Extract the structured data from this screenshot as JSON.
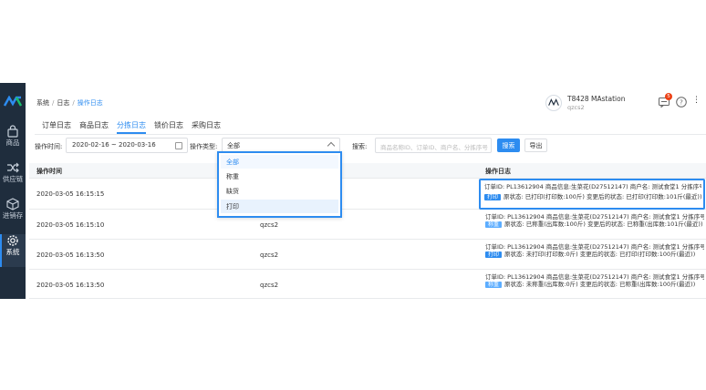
{
  "sidebar": {
    "items": [
      {
        "label": "商品",
        "icon": "bag-icon"
      },
      {
        "label": "供应链",
        "icon": "shuffle-icon"
      },
      {
        "label": "进销存",
        "icon": "cube-icon"
      },
      {
        "label": "系统",
        "icon": "gear-icon"
      }
    ],
    "accent": "#1f2d3d"
  },
  "breadcrumb": {
    "root": "系统",
    "mid": "日志",
    "current": "操作日志"
  },
  "store": {
    "name": "T8428 MAstation",
    "user": "qzcs2"
  },
  "notifications": {
    "count": "5"
  },
  "tabs": [
    {
      "label": "订单日志"
    },
    {
      "label": "商品日志"
    },
    {
      "label": "分拣日志"
    },
    {
      "label": "锁价日志"
    },
    {
      "label": "采购日志"
    }
  ],
  "filters": {
    "time_label": "操作时间:",
    "date_range": "2020-02-16 ~ 2020-03-16",
    "type_label": "操作类型:",
    "type_value": "全部",
    "search_label": "搜索:",
    "search_placeholder": "商品名称ID、订单ID、商户名、分拣序号",
    "search_button": "搜索",
    "export_button": "导出"
  },
  "dropdown": {
    "options": [
      "全部",
      "称重",
      "缺货",
      "打印"
    ]
  },
  "table": {
    "headers": {
      "time": "操作时间",
      "user": "操作人",
      "log": "操作日志"
    },
    "rows": [
      {
        "time": "2020-03-05 16:15:15",
        "user": "qzcs2",
        "line1": "订单ID: PL13612904  商品信息:生菜花(D27512147)  商户名: 测试食堂1  分拣序号: 3",
        "tag": "打印",
        "line2": "原状态: 已打印(打印数:100斤)  变更后的状态: 已打印(打印数:101斤(最近))"
      },
      {
        "time": "2020-03-05 16:15:10",
        "user": "qzcs2",
        "line1": "订单ID: PL13612904  商品信息:生菜花(D27512147)  商户名: 测试食堂1  分拣序号: 3",
        "tag": "称重",
        "line2": "原状态: 已称重(出库数:100斤)  变更后的状态: 已称重(出库数:101斤(最近))"
      },
      {
        "time": "2020-03-05 16:13:50",
        "user": "qzcs2",
        "line1": "订单ID: PL13612904  商品信息:生菜花(D27512147)  商户名: 测试食堂1  分拣序号: 3",
        "tag": "打印",
        "line2": "原状态: 未打印(打印数:0斤)  变更后的状态: 已打印(打印数:100斤(最近))"
      },
      {
        "time": "2020-03-05 16:13:50",
        "user": "qzcs2",
        "line1": "订单ID: PL13612904  商品信息:生菜花(D27512147)  商户名: 测试食堂1  分拣序号: 3",
        "tag": "称重",
        "line2": "原状态: 未称重(出库数:0斤)  变更后的状态: 已称重(出库数:100斤(最近))"
      }
    ]
  },
  "colors": {
    "primary": "#2d8cf0",
    "sidebar": "#1f2d3d",
    "badge": "#ed4014"
  }
}
